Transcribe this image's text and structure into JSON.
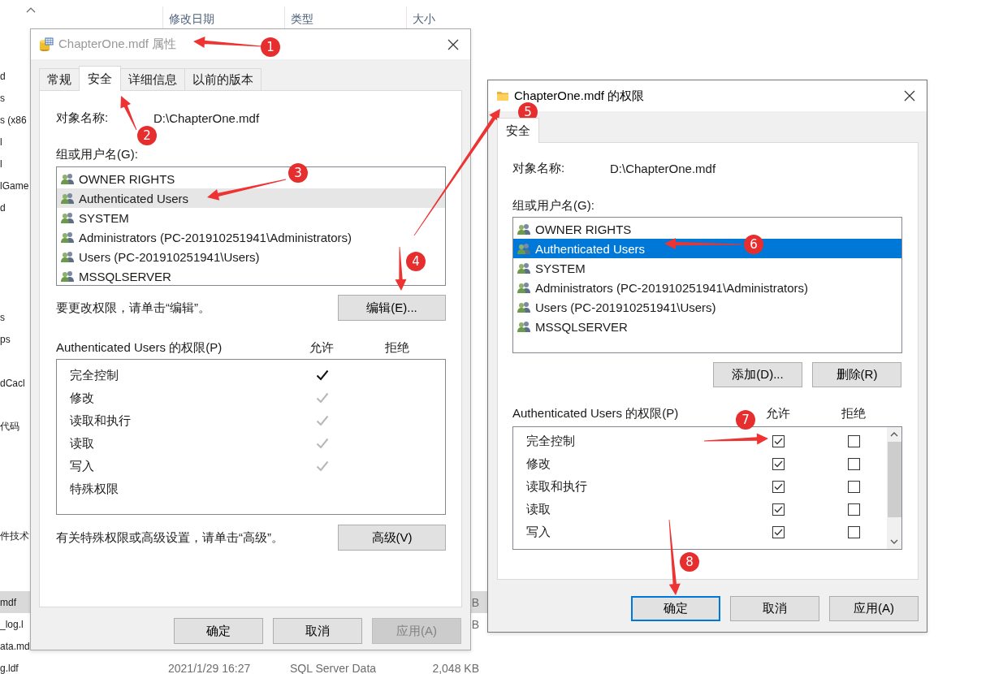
{
  "explorer": {
    "columns": [
      "修改日期",
      "类型",
      "大小"
    ],
    "rows": [
      {
        "name": "d",
        "selected": false
      },
      {
        "name": "s",
        "selected": false
      },
      {
        "name": "s (x86",
        "selected": false
      },
      {
        "name": "l",
        "selected": false
      },
      {
        "name": "l",
        "selected": false
      },
      {
        "name": "lGame",
        "selected": false
      },
      {
        "name": "d",
        "selected": false
      },
      {
        "selected": false
      },
      {
        "selected": false
      },
      {
        "selected": false
      },
      {
        "selected": false
      },
      {
        "name": "s",
        "selected": false
      },
      {
        "name": "ps",
        "selected": false
      },
      {
        "selected": false
      },
      {
        "name": "dCacl",
        "selected": false
      },
      {
        "selected": false
      },
      {
        "name": "代码",
        "selected": false
      },
      {
        "selected": false
      },
      {
        "selected": false
      },
      {
        "selected": false
      },
      {
        "selected": false
      },
      {
        "name": "件技术",
        "selected": false
      },
      {
        "selected": false
      },
      {
        "selected": false
      },
      {
        "name": "mdf",
        "size": "B",
        "selected": true
      },
      {
        "name": "_log.l",
        "size": "B",
        "selected": false
      },
      {
        "name": "ata.md",
        "selected": false
      },
      {
        "name": "g.ldf",
        "date": "2021/1/29 16:27",
        "type": "SQL Server Data",
        "size": "2,048 KB",
        "selected": false
      }
    ]
  },
  "properties_dialog": {
    "title": "ChapterOne.mdf 属性",
    "active": false,
    "tabs": [
      {
        "label": "常规",
        "selected": false
      },
      {
        "label": "安全",
        "selected": true
      },
      {
        "label": "详细信息",
        "selected": false
      },
      {
        "label": "以前的版本",
        "selected": false
      }
    ],
    "object_label": "对象名称:",
    "object_value": "D:\\ChapterOne.mdf",
    "group_label": "组或用户名(G):",
    "principals": [
      {
        "name": "OWNER RIGHTS",
        "selected": false
      },
      {
        "name": "Authenticated Users",
        "selected": true
      },
      {
        "name": "SYSTEM",
        "selected": false
      },
      {
        "name": "Administrators (PC-201910251941\\Administrators)",
        "selected": false
      },
      {
        "name": "Users (PC-201910251941\\Users)",
        "selected": false
      },
      {
        "name": "MSSQLSERVER",
        "selected": false
      }
    ],
    "edit_hint": "要更改权限，请单击“编辑”。",
    "edit_button": "编辑(E)...",
    "permissions_label": "Authenticated Users 的权限(P)",
    "allow_header": "允许",
    "deny_header": "拒绝",
    "permissions": [
      {
        "name": "完全控制",
        "allowed": true,
        "inherited": false
      },
      {
        "name": "修改",
        "allowed": true,
        "inherited": true
      },
      {
        "name": "读取和执行",
        "allowed": true,
        "inherited": true
      },
      {
        "name": "读取",
        "allowed": true,
        "inherited": true
      },
      {
        "name": "写入",
        "allowed": true,
        "inherited": true
      },
      {
        "name": "特殊权限",
        "allowed": false
      }
    ],
    "advanced_hint": "有关特殊权限或高级设置，请单击“高级”。",
    "advanced_button": "高级(V)",
    "buttons": [
      {
        "label": "确定",
        "default": false,
        "disabled": false
      },
      {
        "label": "取消",
        "default": false,
        "disabled": false
      },
      {
        "label": "应用(A)",
        "default": false,
        "disabled": true
      }
    ]
  },
  "permissions_dialog": {
    "title": "ChapterOne.mdf 的权限",
    "active": true,
    "tabs": [
      {
        "label": "安全",
        "selected": true
      }
    ],
    "object_label": "对象名称:",
    "object_value": "D:\\ChapterOne.mdf",
    "group_label": "组或用户名(G):",
    "principals": [
      {
        "name": "OWNER RIGHTS",
        "selected": false
      },
      {
        "name": "Authenticated Users",
        "selected": true
      },
      {
        "name": "SYSTEM",
        "selected": false
      },
      {
        "name": "Administrators (PC-201910251941\\Administrators)",
        "selected": false
      },
      {
        "name": "Users (PC-201910251941\\Users)",
        "selected": false
      },
      {
        "name": "MSSQLSERVER",
        "selected": false
      }
    ],
    "add_button": "添加(D)...",
    "remove_button": "删除(R)",
    "permissions_label": "Authenticated Users 的权限(P)",
    "allow_header": "允许",
    "deny_header": "拒绝",
    "permissions": [
      {
        "name": "完全控制",
        "allow": true,
        "deny": false
      },
      {
        "name": "修改",
        "allow": true,
        "deny": false
      },
      {
        "name": "读取和执行",
        "allow": true,
        "deny": false
      },
      {
        "name": "读取",
        "allow": true,
        "deny": false
      },
      {
        "name": "写入",
        "allow": true,
        "deny": false
      }
    ],
    "buttons": [
      {
        "label": "确定",
        "default": true,
        "disabled": false
      },
      {
        "label": "取消",
        "default": false,
        "disabled": false
      },
      {
        "label": "应用(A)",
        "default": false,
        "disabled": false
      }
    ]
  },
  "annotations": [
    {
      "label": "1"
    },
    {
      "label": "2"
    },
    {
      "label": "3"
    },
    {
      "label": "4"
    },
    {
      "label": "5"
    },
    {
      "label": "6"
    },
    {
      "label": "7"
    },
    {
      "label": "8"
    }
  ]
}
